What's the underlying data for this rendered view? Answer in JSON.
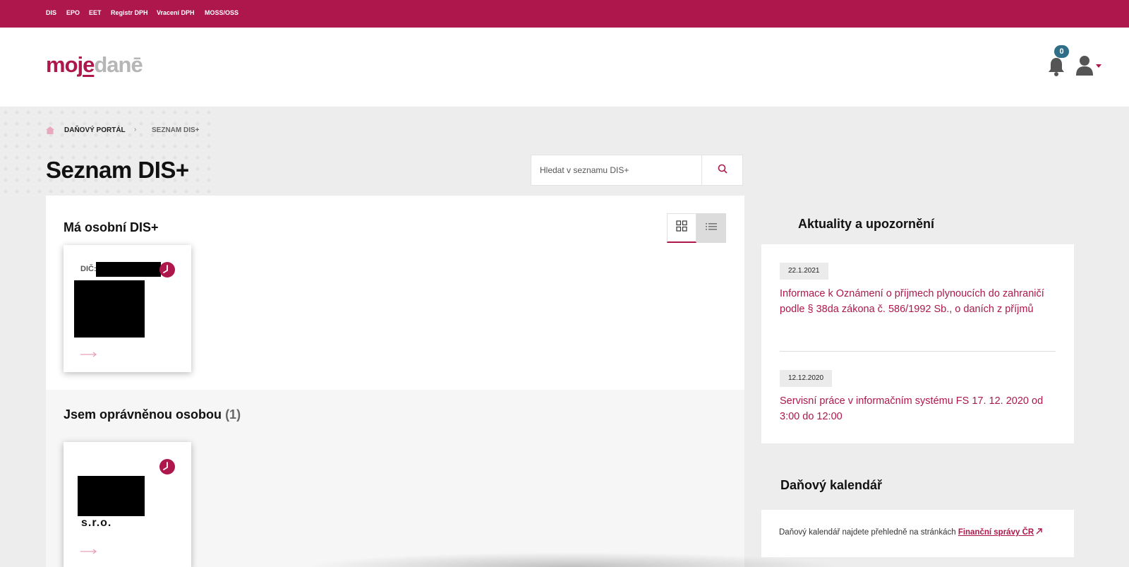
{
  "topnav": {
    "items": [
      {
        "label": "DIS"
      },
      {
        "label": "EPO"
      },
      {
        "label": "EET"
      },
      {
        "label": "Registr DPH"
      },
      {
        "label": "Vracení DPH"
      },
      {
        "label": "MOSS/OSS"
      }
    ]
  },
  "header": {
    "logo_part1": "moj",
    "logo_part2": "e",
    "logo_part3": "dan",
    "logo_part4": "ē",
    "notification_count": "0"
  },
  "breadcrumb": {
    "home_icon": "home-icon",
    "items": [
      {
        "label": "DAŇOVÝ PORTÁL"
      },
      {
        "label": "SEZNAM DIS+"
      }
    ],
    "separator": "›"
  },
  "page": {
    "title": "Seznam DIS+"
  },
  "search": {
    "placeholder": "Hledat v seznamu DIS+"
  },
  "personal_section": {
    "title": "Má osobní DIS+",
    "card": {
      "dic_label": "DIČ:"
    }
  },
  "authorized_section": {
    "title": "Jsem oprávněnou osobou",
    "count": "(1)",
    "card": {
      "name_suffix": "s.r.o."
    }
  },
  "news": {
    "title": "Aktuality a upozornění",
    "items": [
      {
        "date": "22.1.2021",
        "text": "Informace k Oznámení o příjmech plynoucích do zahraničí podle § 38da zákona č. 586/1992 Sb., o daních z příjmů"
      },
      {
        "date": "12.12.2020",
        "text": "Servisní práce v informačním systému FS 17. 12. 2020 od 3:00 do 12:00"
      }
    ]
  },
  "calendar": {
    "title": "Daňový kalendář",
    "text": "Daňový kalendář najdete přehledně na stránkách ",
    "link": "Finanční správy ČR"
  },
  "colors": {
    "brand": "#ad174b",
    "badge": "#2f6e86",
    "background": "#ededed"
  }
}
